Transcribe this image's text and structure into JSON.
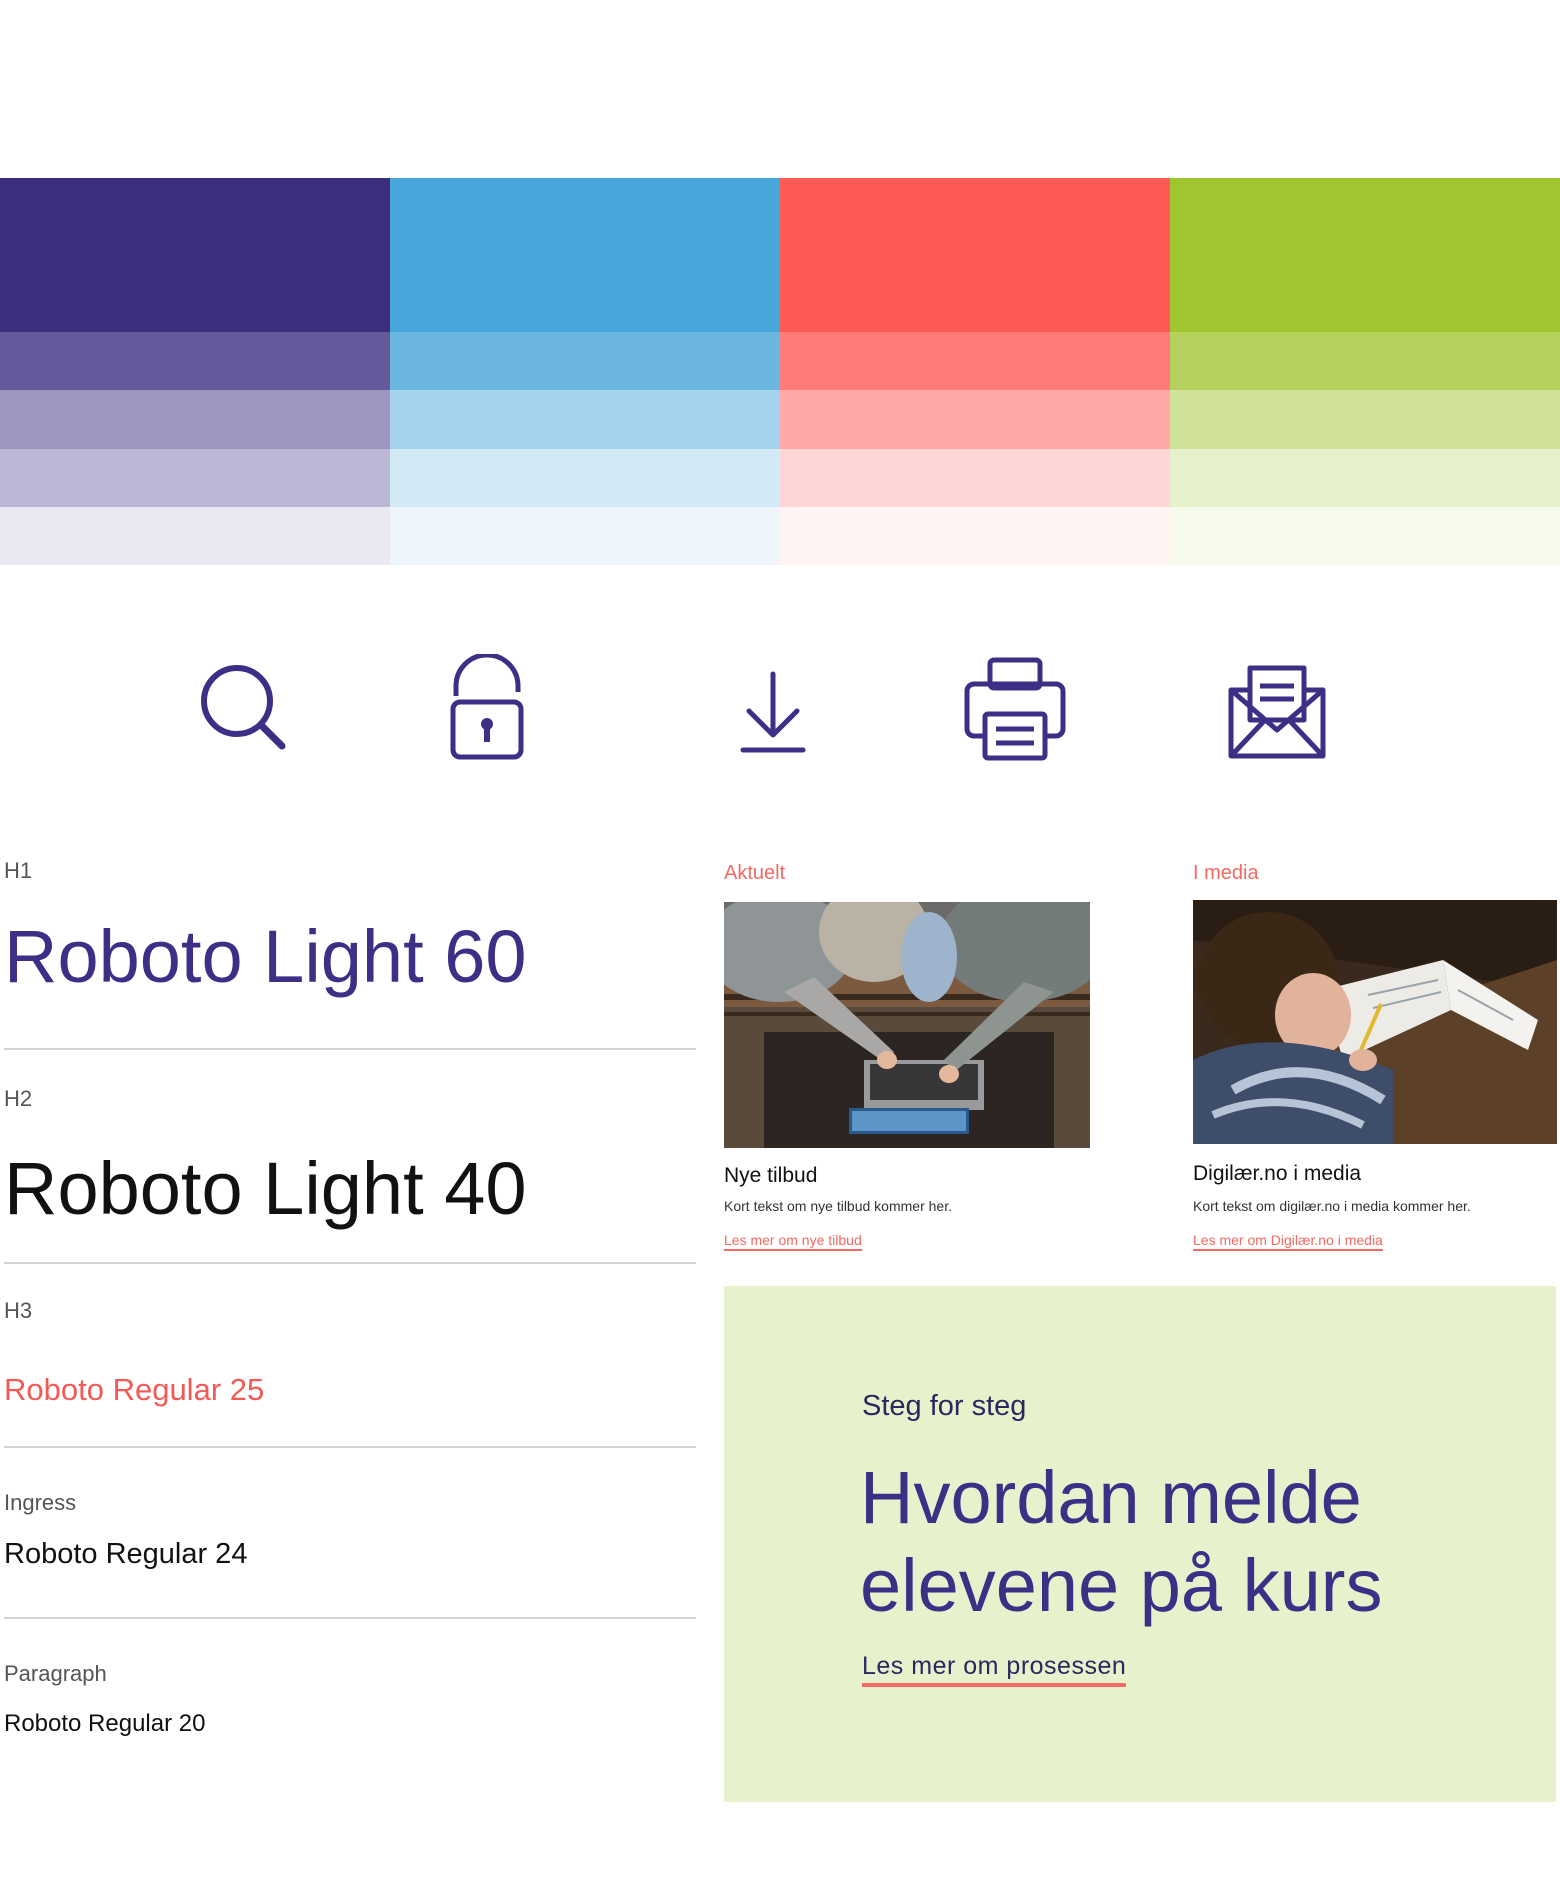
{
  "colors": {
    "purple": [
      "#3d2f80",
      "#655a9c",
      "#9e96c0",
      "#bdb7d6",
      "#ebe8f3"
    ],
    "blue": [
      "#47a6da",
      "#6bb6e1",
      "#a4d3ee",
      "#d2e9f6",
      "#eef6fb"
    ],
    "red": [
      "#fd5a55",
      "#fe7c78",
      "#fea9a7",
      "#fed6d5",
      "#fff3f3"
    ],
    "green": [
      "#a0c62f",
      "#b3d15c",
      "#d0e297",
      "#e6f0cb",
      "#f6faea"
    ],
    "icon": "#3b2f86",
    "accent": "#f26a63",
    "promo_bg": "#e7f1cc"
  },
  "icons": [
    "search-icon",
    "unlock-icon",
    "download-icon",
    "printer-icon",
    "mail-icon"
  ],
  "typography": {
    "h1": {
      "label": "H1",
      "sample": "Roboto Light 60"
    },
    "h2": {
      "label": "H2",
      "sample": "Roboto Light 40"
    },
    "h3": {
      "label": "H3",
      "sample": "Roboto Regular 25"
    },
    "ingress": {
      "label": "Ingress",
      "sample": "Roboto Regular 24"
    },
    "paragraph": {
      "label": "Paragraph",
      "sample": "Roboto Regular 20"
    }
  },
  "cards": [
    {
      "category": "Aktuelt",
      "title": "Nye tilbud",
      "text": "Kort tekst om nye tilbud kommer her.",
      "link": "Les mer om nye tilbud"
    },
    {
      "category": "I media",
      "title": "Digilær.no i media",
      "text": "Kort tekst om digilær.no i media kommer her.",
      "link": "Les mer om Digilær.no i media"
    }
  ],
  "promo": {
    "kicker": "Steg for steg",
    "title": "Hvordan melde elevene på kurs",
    "link": "Les mer om prosessen"
  }
}
